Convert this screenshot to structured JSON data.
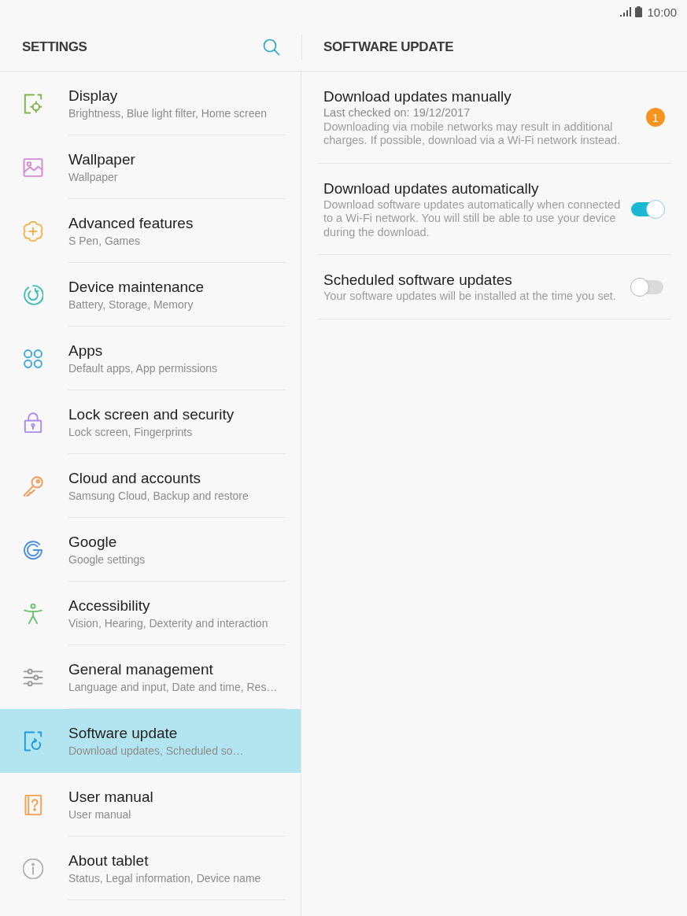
{
  "status_bar": {
    "time": "10:00"
  },
  "settings_panel": {
    "title": "SETTINGS",
    "items": [
      {
        "title": "Display",
        "subtitle": "Brightness, Blue light filter, Home screen",
        "selected": false
      },
      {
        "title": "Wallpaper",
        "subtitle": "Wallpaper",
        "selected": false
      },
      {
        "title": "Advanced features",
        "subtitle": "S Pen, Games",
        "selected": false
      },
      {
        "title": "Device maintenance",
        "subtitle": "Battery, Storage, Memory",
        "selected": false
      },
      {
        "title": "Apps",
        "subtitle": "Default apps, App permissions",
        "selected": false
      },
      {
        "title": "Lock screen and security",
        "subtitle": "Lock screen, Fingerprints",
        "selected": false
      },
      {
        "title": "Cloud and accounts",
        "subtitle": "Samsung Cloud, Backup and restore",
        "selected": false
      },
      {
        "title": "Google",
        "subtitle": "Google settings",
        "selected": false
      },
      {
        "title": "Accessibility",
        "subtitle": "Vision, Hearing, Dexterity and interaction",
        "selected": false
      },
      {
        "title": "General management",
        "subtitle": "Language and input, Date and time, Res…",
        "selected": false
      },
      {
        "title": "Software update",
        "subtitle": "Download updates, Scheduled so…",
        "selected": true
      },
      {
        "title": "User manual",
        "subtitle": "User manual",
        "selected": false
      },
      {
        "title": "About tablet",
        "subtitle": "Status, Legal information, Device name",
        "selected": false
      }
    ]
  },
  "detail_panel": {
    "title": "SOFTWARE UPDATE",
    "options": [
      {
        "kind": "badge",
        "title": "Download updates manually",
        "status": "Last checked on: 19/12/2017",
        "description": "Downloading via mobile networks may result in additional charges. If possible, download via a Wi-Fi network instead.",
        "badge": "1"
      },
      {
        "kind": "toggle",
        "title": "Download updates automatically",
        "description": "Download software updates automatically when connected to a Wi-Fi network. You will still be able to use your device during the download.",
        "on": true
      },
      {
        "kind": "toggle",
        "title": "Scheduled software updates",
        "description": "Your software updates will be installed at the time you set.",
        "on": false
      }
    ]
  }
}
